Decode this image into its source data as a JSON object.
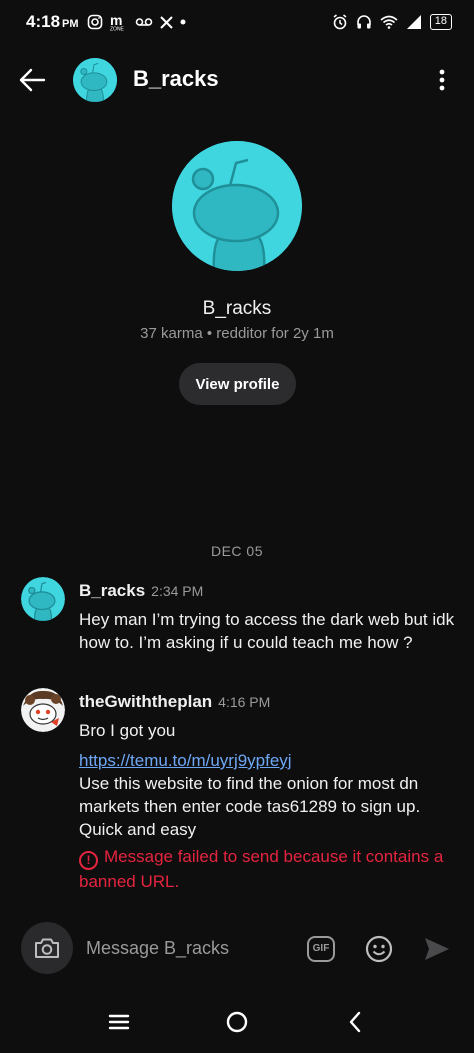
{
  "status_bar": {
    "time": "4:18",
    "ampm": "PM",
    "battery": "18"
  },
  "header": {
    "title": "B_racks"
  },
  "profile": {
    "name": "B_racks",
    "meta": "37 karma • redditor for 2y 1m",
    "view_profile_label": "View profile"
  },
  "date_separator": "DEC 05",
  "messages": [
    {
      "user": "B_racks",
      "time": "2:34 PM",
      "text": "Hey man I’m trying to access the dark web but idk how to. I’m asking if u could teach me how ?"
    },
    {
      "user": "theGwiththeplan",
      "time": "4:16 PM",
      "text_line1": "Bro I got you",
      "link": "https://temu.to/m/uyrj9ypfeyj",
      "text_line2": "Use this website to find the onion for most dn markets then enter code tas61289 to sign up. Quick and easy",
      "error": "Message failed to send because it contains a banned URL."
    }
  ],
  "composer": {
    "placeholder": "Message B_racks",
    "gif_label": "GIF"
  },
  "colors": {
    "background": "#0e0e0f",
    "avatar_teal": "#3fd6e0",
    "link": "#6ea7f5",
    "error": "#e5243f"
  }
}
